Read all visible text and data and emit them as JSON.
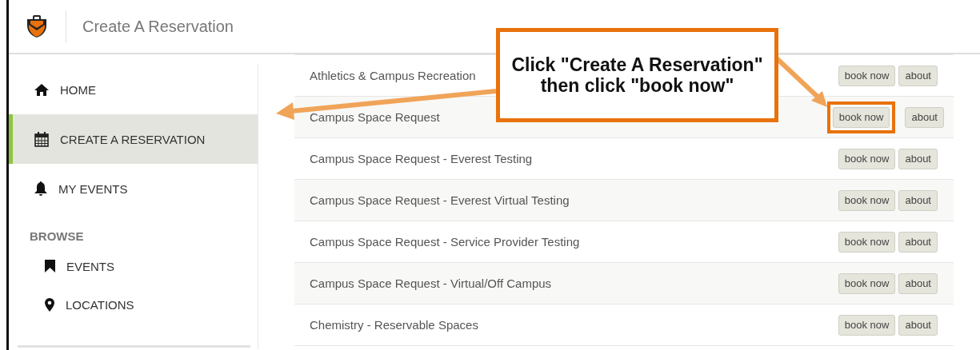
{
  "header": {
    "title": "Create A Reservation"
  },
  "sidebar": {
    "items": [
      {
        "label": "HOME",
        "selected": false
      },
      {
        "label": "CREATE A RESERVATION",
        "selected": true
      },
      {
        "label": "MY EVENTS",
        "selected": false
      }
    ],
    "section_title": "BROWSE",
    "section_items": [
      {
        "label": "EVENTS"
      },
      {
        "label": "LOCATIONS"
      }
    ]
  },
  "rows": [
    {
      "name": "Athletics & Campus Recreation",
      "book_label": "book now",
      "about_label": "about",
      "highlighted": false
    },
    {
      "name": "Campus Space Request",
      "book_label": "book now",
      "about_label": "about",
      "highlighted": true
    },
    {
      "name": "Campus Space Request - Everest Testing",
      "book_label": "book now",
      "about_label": "about",
      "highlighted": false
    },
    {
      "name": "Campus Space Request - Everest Virtual Testing",
      "book_label": "book now",
      "about_label": "about",
      "highlighted": false
    },
    {
      "name": "Campus Space Request - Service Provider Testing",
      "book_label": "book now",
      "about_label": "about",
      "highlighted": false
    },
    {
      "name": "Campus Space Request - Virtual/Off Campus",
      "book_label": "book now",
      "about_label": "about",
      "highlighted": false
    },
    {
      "name": "Chemistry - Reservable Spaces",
      "book_label": "book now",
      "about_label": "about",
      "highlighted": false
    }
  ],
  "annotation": {
    "text": "Click \"Create A Reservation\" then click \"book now\""
  }
}
